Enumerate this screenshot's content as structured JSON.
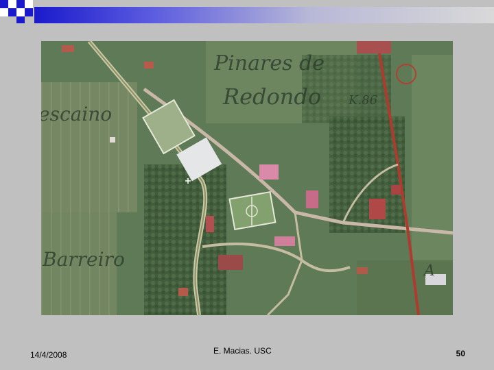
{
  "slide": {
    "date": "14/4/2008",
    "author": "E. Macias. USC",
    "page_number": "50"
  },
  "map": {
    "labels": {
      "pinares_line1": "Pinares de",
      "pinares_line2": "Redondo",
      "km": "K.86",
      "left_place": "escaino",
      "bottom_place": "Barreiro",
      "corner_letter": "A"
    }
  },
  "colors": {
    "slide_background": "#c0c0c0",
    "accent_blue": "#1a1acc"
  }
}
